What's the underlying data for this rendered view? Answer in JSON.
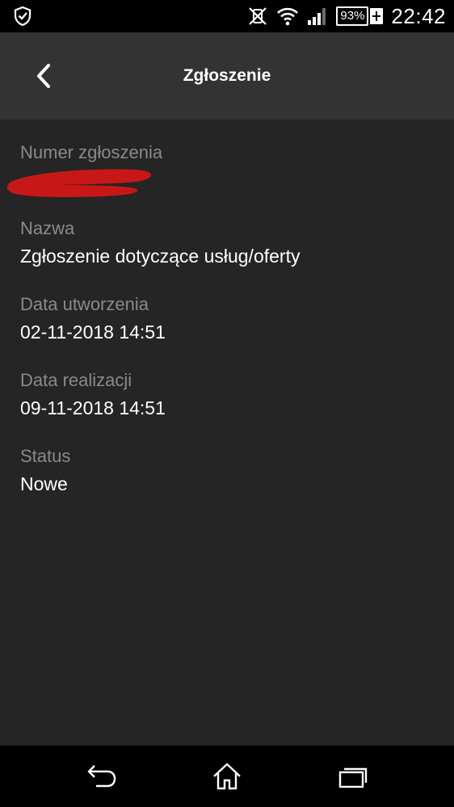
{
  "status_bar": {
    "icons": [
      "shield-check-icon",
      "vibrate-off-icon",
      "wifi-icon",
      "signal-icon"
    ],
    "battery_percent": "93%",
    "time": "22:42"
  },
  "header": {
    "title": "Zgłoszenie",
    "back_icon": "chevron-left-icon"
  },
  "fields": [
    {
      "label": "Numer zgłoszenia",
      "value": ""
    },
    {
      "label": "Nazwa",
      "value": "Zgłoszenie dotyczące usług/oferty"
    },
    {
      "label": "Data utworzenia",
      "value": "02-11-2018 14:51"
    },
    {
      "label": "Data realizacji",
      "value": "09-11-2018 14:51"
    },
    {
      "label": "Status",
      "value": "Nowe"
    }
  ],
  "nav_bar": {
    "icons": [
      "back-arrow-icon",
      "home-icon",
      "recent-apps-icon"
    ]
  },
  "colors": {
    "background": "#252525",
    "app_bar": "#333333",
    "label": "#8a8a8a",
    "value": "#ffffff",
    "redaction": "#c81717"
  }
}
